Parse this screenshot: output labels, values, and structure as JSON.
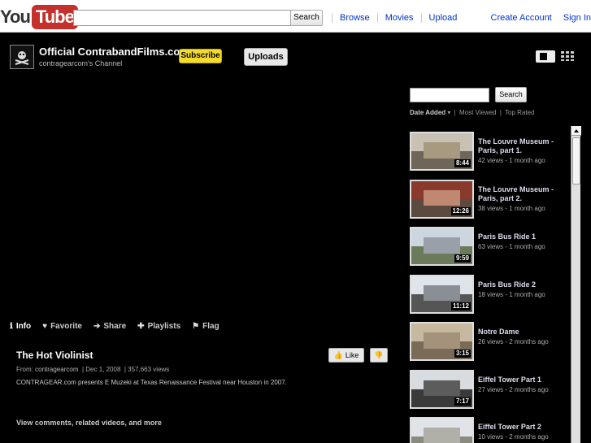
{
  "header": {
    "logo_you": "You",
    "logo_tube": "Tube",
    "search_button": "Search",
    "nav": [
      "Browse",
      "Movies",
      "Upload"
    ],
    "create_account": "Create Account",
    "sign_in": "Sign In"
  },
  "channel": {
    "title": "Official ContrabandFilms.com",
    "subtitle": "contragearcom's Channel",
    "subscribe": "Subscribe",
    "uploads": "Uploads"
  },
  "actions": {
    "info": "Info",
    "favorite": "Favorite",
    "share": "Share",
    "playlists": "Playlists",
    "flag": "Flag"
  },
  "video": {
    "title": "The Hot Violinist",
    "from_label": "From:",
    "from_user": "contragearcom",
    "date": "Dec 1, 2008",
    "views": "357,663 views",
    "description": "CONTRAGEAR.com presents E Muzeki at Texas Renaissance Festival near Houston in 2007.",
    "like": "Like",
    "more": "View comments, related videos, and more"
  },
  "sidebar": {
    "search_button": "Search",
    "sort_selected": "Date Added",
    "sort_most_viewed": "Most Viewed",
    "sort_top_rated": "Top Rated",
    "videos": [
      {
        "title": "The Louvre Museum - Paris, part 1.",
        "meta": "42 views - 1 month ago",
        "duration": "8:44",
        "sky": "#c9c2b4",
        "ground": "#6e6658",
        "mid": "#a89a80"
      },
      {
        "title": "The Louvre Museum - Paris, part 2.",
        "meta": "38 views - 1 month ago",
        "duration": "12:26",
        "sky": "#8a3a2c",
        "ground": "#5a4a40",
        "mid": "#c08870"
      },
      {
        "title": "Paris Bus Ride 1",
        "meta": "63 views - 1 month ago",
        "duration": "9:59",
        "sky": "#cdd6de",
        "ground": "#6a7a5a",
        "mid": "#9aa0a8"
      },
      {
        "title": "Paris Bus Ride 2",
        "meta": "18 views - 1 month ago",
        "duration": "11:12",
        "sky": "#dfe4ea",
        "ground": "#555555",
        "mid": "#8a8f96"
      },
      {
        "title": "Notre Dame",
        "meta": "26 views - 2 months ago",
        "duration": "3:15",
        "sky": "#c7b8a0",
        "ground": "#7a6a58",
        "mid": "#a4927a"
      },
      {
        "title": "Eiffel Tower Part 1",
        "meta": "27 views - 2 months ago",
        "duration": "7:17",
        "sky": "#d8dce0",
        "ground": "#3a3a3a",
        "mid": "#5c5c5c"
      },
      {
        "title": "Eiffel Tower Part 2",
        "meta": "10 views - 2 months ago",
        "duration": "",
        "sky": "#e0e4e8",
        "ground": "#8a8a80",
        "mid": "#b0b0a8"
      }
    ]
  }
}
